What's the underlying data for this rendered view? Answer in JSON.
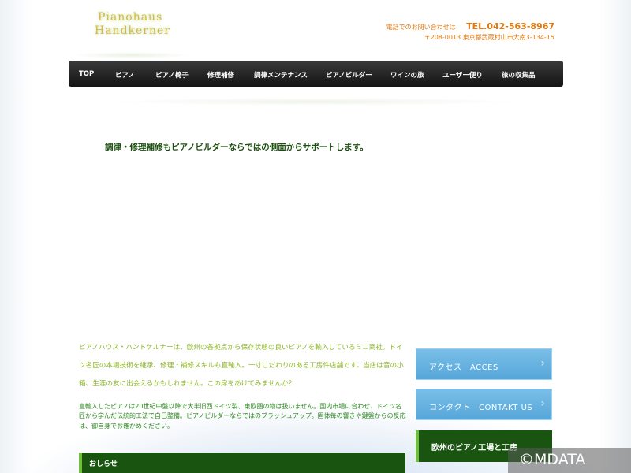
{
  "logo": {
    "line1": "Pianohaus",
    "line2": "Handkerner"
  },
  "contact": {
    "label": "電話でのお問い合わせは",
    "tel": "TEL.042-563-8967",
    "address": "〒208-0013 東京都武蔵村山市大南3-134-15"
  },
  "nav": {
    "items": [
      "TOP",
      "ピアノ",
      "ピアノ椅子",
      "修理補修",
      "調律メンテナンス",
      "ピアノビルダー",
      "ワインの旅",
      "ユーザー便り",
      "旅の収集品"
    ]
  },
  "headline": "調律・修理補修もピアノビルダーならではの側面からサポートします。",
  "intro": "ピアノハウス・ハントケルナーは、欧州の各拠点から保存状態の良いピアノを輸入しているミニ商社。ドイツ名匠の本場技術を継承、修理・補修スキルも直輸入。一寸こだわりのある工房件店舗です。当店は音の小箱、生涯の友に出会えるかもしれません。この扉をあけてみませんか？",
  "detail": "直輸入したピアノは20世紀中盤以降で大半旧西ドイツ製、東欧圏の物は扱いません。国内市場に合わせ、ドイツ名匠から学んだ伝統的工法で自己整備。ピアノビルダーならではのブラッシュアップ。固体毎の響きや鍵盤からの反応は、御自身でお確かめください。",
  "news": {
    "title": "おしらせ"
  },
  "side": {
    "acces": "アクセス　ACCES",
    "contact": "コンタクト　CONTAKT US",
    "factory": "欧州のピアノ工場と工房"
  },
  "watermark": "©MDATA",
  "colors": {
    "nav_bg": "#1a1a1a",
    "accent_green": "#195510",
    "side_blue": "#62aee0",
    "contact_orange": "#e07a12"
  }
}
